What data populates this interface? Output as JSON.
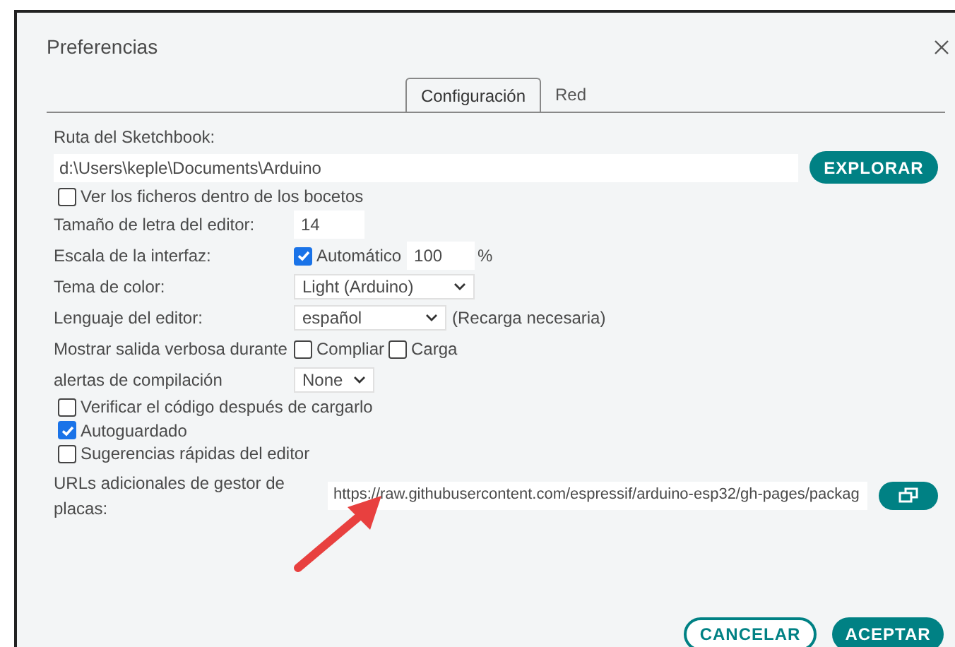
{
  "window": {
    "title": "Preferencias"
  },
  "tabs": [
    {
      "label": "Configuración",
      "selected": true
    },
    {
      "label": "Red",
      "selected": false
    }
  ],
  "sketchbook": {
    "label": "Ruta del Sketchbook:",
    "value": "d:\\Users\\keple\\Documents\\Arduino",
    "button": "EXPLORAR"
  },
  "show_files": {
    "label": "Ver los ficheros dentro de los bocetos",
    "checked": false
  },
  "rows": [
    {
      "kind": "field",
      "label": "Tamaño de letra del editor:",
      "value": "14"
    },
    {
      "kind": "scale",
      "label": "Escala de la interfaz:",
      "check_label": "Automático",
      "checked": true,
      "value": "100",
      "unit": "%"
    },
    {
      "kind": "select",
      "label": "Tema de color:",
      "value": "Light (Arduino)"
    },
    {
      "kind": "select",
      "label": "Lenguaje del editor:",
      "value": "español",
      "note": "(Recarga necesaria)"
    },
    {
      "kind": "checks",
      "label": "Mostrar salida verbosa durante",
      "options": [
        {
          "label": "Compliar",
          "checked": false
        },
        {
          "label": "Carga",
          "checked": false
        }
      ]
    },
    {
      "kind": "select",
      "label": "alertas de compilación",
      "value": "None"
    }
  ],
  "options": [
    {
      "label": "Verificar el código después de cargarlo",
      "checked": false
    },
    {
      "label": "Autoguardado",
      "checked": true
    },
    {
      "label": "Sugerencias rápidas del editor",
      "checked": false
    }
  ],
  "urls": {
    "label": "URLs adicionales de gestor de placas:",
    "value": "https://raw.githubusercontent.com/espressif/arduino-esp32/gh-pages/packag"
  },
  "buttons": [
    {
      "label": "CANCELAR",
      "kind": "secondary"
    },
    {
      "label": "ACEPTAR",
      "kind": "primary"
    }
  ]
}
